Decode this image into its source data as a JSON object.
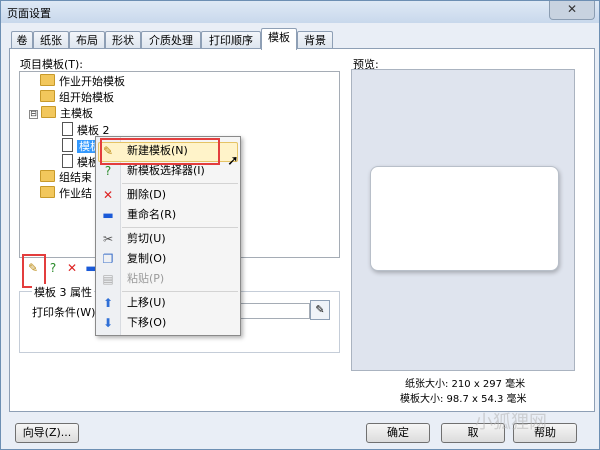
{
  "window": {
    "title": "页面设置",
    "close_icon": "close-icon"
  },
  "tabs": [
    {
      "label": "卷"
    },
    {
      "label": "纸张"
    },
    {
      "label": "布局"
    },
    {
      "label": "形状"
    },
    {
      "label": "介质处理"
    },
    {
      "label": "打印顺序"
    },
    {
      "label": "模板",
      "active": true
    },
    {
      "label": "背景"
    }
  ],
  "templates": {
    "label": "项目模板(T):",
    "tree": [
      {
        "label": "作业开始模板",
        "icon": "folder-icon"
      },
      {
        "label": "组开始模板",
        "icon": "folder-icon"
      },
      {
        "label": "主模板",
        "icon": "folder-open-icon",
        "expander": "⊟"
      },
      {
        "label": "模板 2",
        "icon": "document-icon"
      },
      {
        "label": "模板",
        "icon": "document-icon",
        "selected": true
      },
      {
        "label": "模板",
        "icon": "document-icon"
      },
      {
        "label": "组结束",
        "icon": "folder-icon"
      },
      {
        "label": "作业结",
        "icon": "folder-icon"
      }
    ]
  },
  "context_menu": {
    "items": [
      {
        "label": "新建模板(N)",
        "icon": "new-template-icon",
        "highlighted": true
      },
      {
        "label": "新模板选择器(I)",
        "icon": "help-wizard-icon"
      },
      {
        "label": "删除(D)",
        "icon": "delete-icon"
      },
      {
        "label": "重命名(R)",
        "icon": "rename-icon"
      },
      {
        "label": "剪切(U)",
        "icon": "cut-icon"
      },
      {
        "label": "复制(O)",
        "icon": "copy-icon"
      },
      {
        "label": "粘贴(P)",
        "icon": "paste-icon",
        "disabled": true
      },
      {
        "label": "上移(U)",
        "icon": "arrow-up-icon"
      },
      {
        "label": "下移(O)",
        "icon": "arrow-down-icon"
      }
    ]
  },
  "properties": {
    "header": "模板 3 属性",
    "print_condition_label": "打印条件(W):",
    "print_condition_value": ""
  },
  "preview": {
    "label": "预览:",
    "paper_size": "纸张大小: 210 x 297 毫米",
    "template_size": "模板大小: 98.7 x 54.3 毫米"
  },
  "buttons": {
    "wizard": "向导(Z)...",
    "ok": "确定",
    "cancel": "取",
    "help": "帮助"
  },
  "watermark": "小狐狸网",
  "colors": {
    "highlight_box": "#e33d3d",
    "selection": "#3399ff",
    "menu_highlight": "#fff3c9"
  }
}
